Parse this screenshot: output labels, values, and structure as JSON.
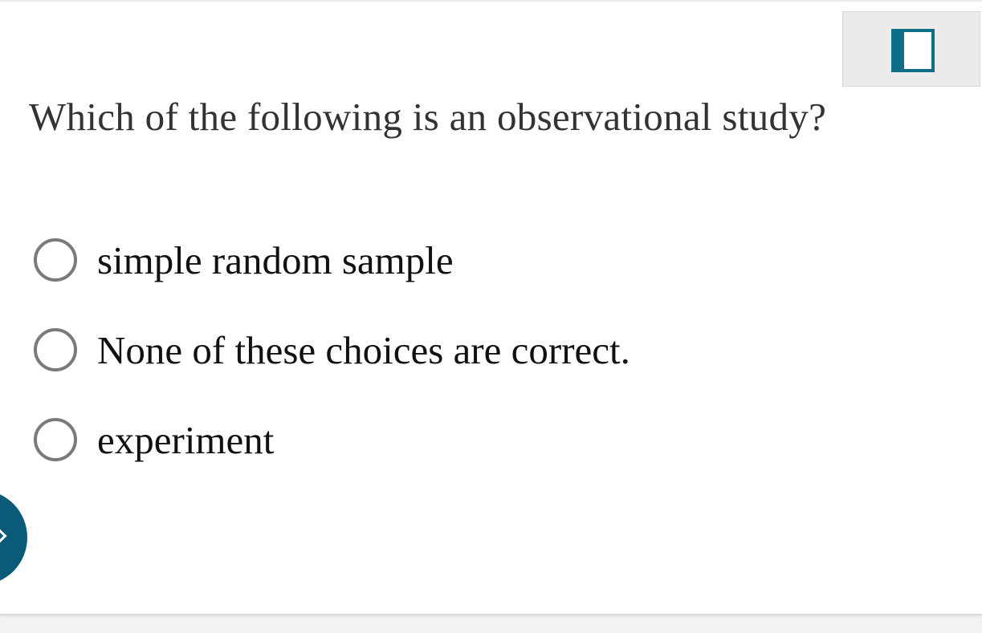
{
  "question": {
    "text": "Which of the following is an observational study?"
  },
  "options": [
    {
      "label": "simple random sample",
      "selected": false
    },
    {
      "label": "None of these choices are correct.",
      "selected": false
    },
    {
      "label": "experiment",
      "selected": false
    }
  ],
  "toolbar": {
    "bookmark_icon": "bookmark-flag-icon"
  },
  "side_tab": {
    "icon": "chevron-right-icon"
  },
  "colors": {
    "accent": "#0e6d87",
    "side_tab": "#0c5a7a",
    "radio_border": "#7a7a7a",
    "text": "#333333"
  }
}
